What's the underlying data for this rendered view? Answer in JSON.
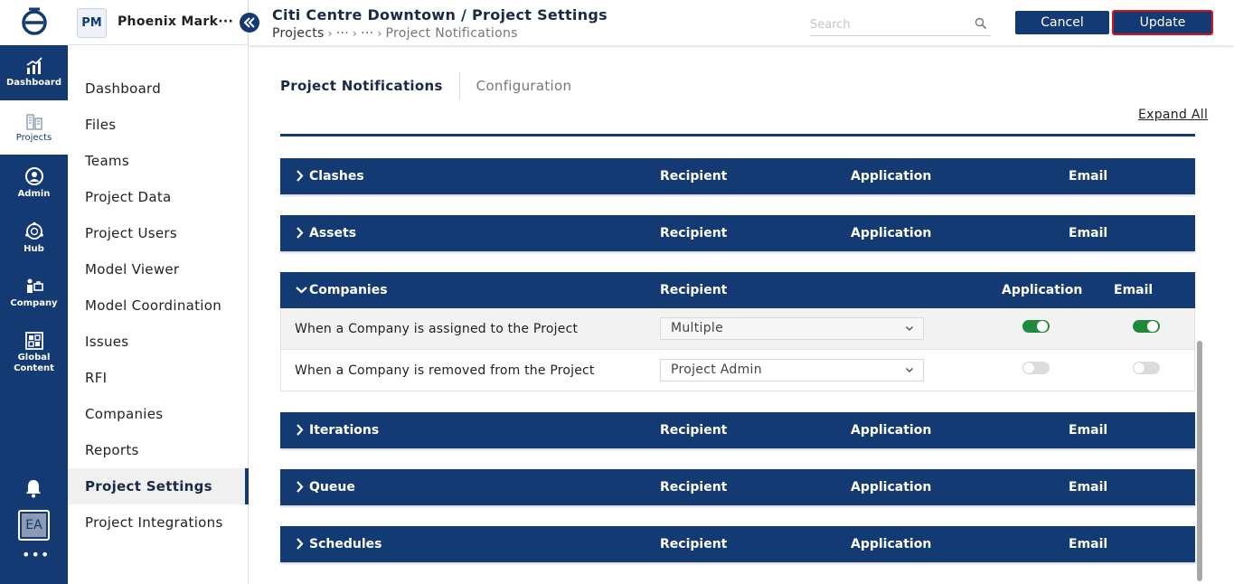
{
  "rail": {
    "items": [
      {
        "label": "Dashboard",
        "icon": "chart-icon"
      },
      {
        "label": "Projects",
        "icon": "buildings-icon",
        "active": true
      },
      {
        "label": "Admin",
        "icon": "user-circle-icon"
      },
      {
        "label": "Hub",
        "icon": "globe-hub-icon"
      },
      {
        "label": "Company",
        "icon": "company-people-icon"
      },
      {
        "label": "Global Content",
        "icon": "grid-content-icon"
      }
    ],
    "avatar": "EA",
    "more": "•••"
  },
  "sidebar": {
    "badge": "PM",
    "project_name": "Phoenix Mark···",
    "items": [
      {
        "label": "Dashboard"
      },
      {
        "label": "Files"
      },
      {
        "label": "Teams"
      },
      {
        "label": "Project Data"
      },
      {
        "label": "Project Users"
      },
      {
        "label": "Model Viewer"
      },
      {
        "label": "Model Coordination"
      },
      {
        "label": "Issues"
      },
      {
        "label": "RFI"
      },
      {
        "label": "Companies"
      },
      {
        "label": "Reports"
      },
      {
        "label": "Project Settings",
        "active": true
      },
      {
        "label": "Project Integrations"
      }
    ]
  },
  "header": {
    "title": "Citi Centre Downtown / Project Settings",
    "breadcrumb": {
      "root": "Projects",
      "ellipsis1": "···",
      "ellipsis2": "···",
      "current": "Project Notifications"
    },
    "search_placeholder": "Search",
    "cancel_label": "Cancel",
    "update_label": "Update"
  },
  "tabs": [
    {
      "label": "Project Notifications",
      "active": true
    },
    {
      "label": "Configuration",
      "active": false
    }
  ],
  "expand_all": "Expand All",
  "colors": {
    "primary": "#143a73",
    "toggle_on": "#1f8a3b",
    "highlight": "#d9141a"
  },
  "sections": [
    {
      "title": "Clashes",
      "recipient": "Recipient",
      "application": "Application",
      "email": "Email",
      "expanded": false
    },
    {
      "title": "Assets",
      "recipient": "Recipient",
      "application": "Application",
      "email": "Email",
      "expanded": false
    },
    {
      "title": "Companies",
      "recipient": "Recipient",
      "application": "Application",
      "email": "Email",
      "expanded": true,
      "rows": [
        {
          "label": "When a Company is assigned to the Project",
          "recipient": "Multiple",
          "application": true,
          "email": true
        },
        {
          "label": "When a Company is removed from the Project",
          "recipient": "Project Admin",
          "application": false,
          "email": false
        }
      ]
    },
    {
      "title": "Iterations",
      "recipient": "Recipient",
      "application": "Application",
      "email": "Email",
      "expanded": false
    },
    {
      "title": "Queue",
      "recipient": "Recipient",
      "application": "Application",
      "email": "Email",
      "expanded": false
    },
    {
      "title": "Schedules",
      "recipient": "Recipient",
      "application": "Application",
      "email": "Email",
      "expanded": false
    }
  ]
}
